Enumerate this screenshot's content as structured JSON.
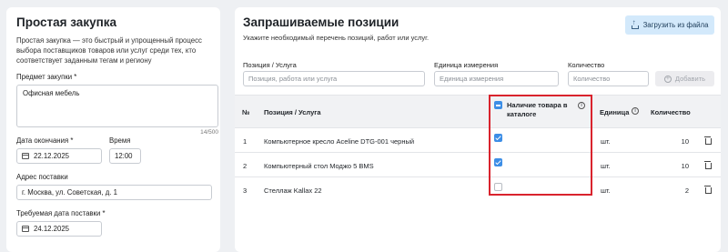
{
  "left": {
    "title": "Простая закупка",
    "description": "Простая закупка — это быстрый и упрощенный процесс выбора поставщиков товаров или услуг среди тех, кто соответствует заданным тегам и региону",
    "subject_label": "Предмет закупки *",
    "subject_value": "Офисная мебель",
    "subject_counter": "14/500",
    "end_date_label": "Дата окончания *",
    "end_date_value": "22.12.2025",
    "time_label": "Время",
    "time_value": "12:00",
    "address_label": "Адрес поставки",
    "address_value": "г. Москва, ул. Советская, д. 1",
    "delivery_date_label": "Требуемая дата поставки *",
    "delivery_date_value": "24.12.2025"
  },
  "right": {
    "title": "Запрашиваемые позиции",
    "subtitle": "Укажите необходимый перечень позиций, работ или услуг.",
    "upload_label": "Загрузить из файла",
    "position_label": "Позиция / Услуга",
    "position_placeholder": "Позиция, работа или услуга",
    "unit_label": "Единица измерения",
    "unit_placeholder": "Единица измерения",
    "qty_label": "Количество",
    "qty_placeholder": "Количество",
    "add_label": "Добавить"
  },
  "table": {
    "headers": {
      "num": "№",
      "position": "Позиция / Услуга",
      "catalog": "Наличие товара в каталоге",
      "unit": "Единица",
      "qty": "Количество"
    },
    "rows": [
      {
        "num": "1",
        "name": "Компьютерное кресло Aceline DTG-001 черный",
        "in_catalog": true,
        "unit": "шт.",
        "qty": "10"
      },
      {
        "num": "2",
        "name": "Компьютерный стол Моджо 5 BMS",
        "in_catalog": true,
        "unit": "шт.",
        "qty": "10"
      },
      {
        "num": "3",
        "name": "Стеллаж Kallax 22",
        "in_catalog": false,
        "unit": "шт.",
        "qty": "2"
      }
    ]
  },
  "colors": {
    "accent": "#3d8ee6",
    "highlight": "#d9232d",
    "upload_bg": "#d3e9fb"
  }
}
